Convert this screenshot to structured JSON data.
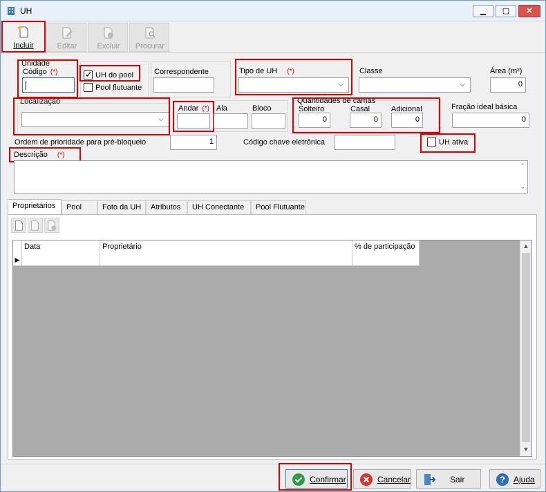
{
  "window": {
    "title": "UH"
  },
  "toolbar": {
    "incluir": "Incluir",
    "editar": "Editar",
    "excluir": "Excluir",
    "procurar": "Procurar"
  },
  "form": {
    "unidade": "Unidade",
    "codigo": "Código",
    "required_mark": "(*)",
    "uh_do_pool": "UH do pool",
    "uh_do_pool_checked": true,
    "pool_flutuante": "Pool flutuante",
    "correspondente": "Correspondente",
    "tipo_de_uh": "Tipo de UH",
    "classe": "Classe",
    "area": "Área (m²)",
    "area_value": "0",
    "localizacao": "Localização",
    "andar": "Andar",
    "ala": "Ala",
    "bloco": "Bloco",
    "quantidades_de_camas": "Quantidades de camas",
    "solteiro": "Solteiro",
    "solteiro_value": "0",
    "casal": "Casal",
    "casal_value": "0",
    "adicional": "Adicional",
    "adicional_value": "0",
    "fracao_ideal_basica": "Fração ideal básica",
    "fracao_value": "0",
    "ordem_prioridade": "Ordem de prioridade para pré-bloqueio",
    "ordem_value": "1",
    "codigo_chave": "Código chave eletrônica",
    "uh_ativa": "UH ativa",
    "descricao": "Descrição"
  },
  "tabs": [
    "Proprietários",
    "Pool",
    "Foto da UH",
    "Atributos",
    "UH Conectante",
    "Pool Flutuante"
  ],
  "grid": {
    "columns": [
      "Data",
      "Proprietário",
      "% de participação"
    ]
  },
  "bottom": {
    "confirmar": "Confirmar",
    "cancelar": "Cancelar",
    "sair": "Sair",
    "ajuda": "Ajuda"
  },
  "colors": {
    "highlight_red": "#e00000",
    "required_red": "#d00000",
    "window_border": "#6a9ec4"
  }
}
